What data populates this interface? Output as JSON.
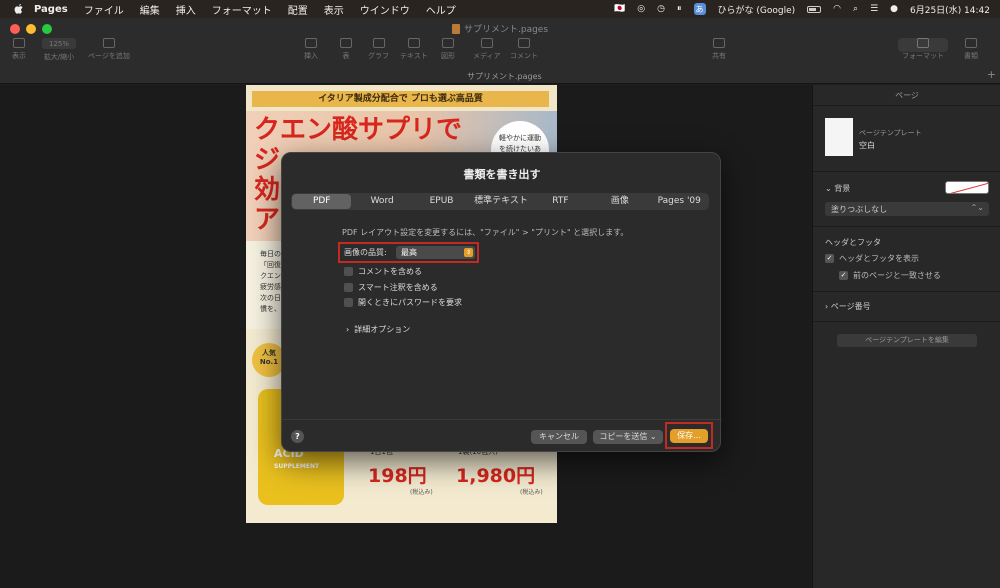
{
  "menubar": {
    "app_name": "Pages",
    "items": [
      "ファイル",
      "編集",
      "挿入",
      "フォーマット",
      "配置",
      "表示",
      "ウインドウ",
      "ヘルプ"
    ],
    "ime_badge": "あ",
    "ime_label": "ひらがな (Google)",
    "datetime": "6月25日(水) 14:42"
  },
  "window": {
    "title": "サプリメント.pages",
    "subtitle": "サプリメント.pages",
    "toolbar": {
      "view": "表示",
      "zoom_value": "125%",
      "zoom": "拡大/縮小",
      "add_page": "ページを追加",
      "insert": "挿入",
      "table": "表",
      "chart": "グラフ",
      "text": "テキスト",
      "shape": "図形",
      "media": "メディア",
      "comment": "コメント",
      "share": "共有",
      "format": "フォーマット",
      "document": "書類"
    }
  },
  "document_page": {
    "banner": "イタリア製成分配合で プロも選ぶ高品質",
    "hero_title": "クエン酸サプリで\nジ\n効\nア",
    "bubble": "軽やかに運動を続けたいあなたへ",
    "mid_text": "毎日の\n「回復\nクエン\n疲労感\n次の日\n慣を、",
    "badge": "人気\nNo.1",
    "bottle_line1": "ACID",
    "bottle_line2": "SUPPLEMENT",
    "price1_label": "1日1包",
    "price1": "198円",
    "price1_tax": "(税込み)",
    "price2_label": "1袋(10包入)",
    "price2": "1,980円",
    "price2_tax": "(税込み)"
  },
  "sidebar": {
    "title": "ページ",
    "template_label": "ページテンプレート",
    "template_value": "空白",
    "background_label": "背景",
    "fill_select": "塗りつぶしなし",
    "header_footer_label": "ヘッダとフッタ",
    "show_header_footer": "ヘッダとフッタを表示",
    "match_previous": "前のページと一致させる",
    "page_number": "ページ番号",
    "edit_template_button": "ページテンプレートを編集"
  },
  "dialog": {
    "title": "書類を書き出す",
    "tabs": [
      "PDF",
      "Word",
      "EPUB",
      "標準テキスト",
      "RTF",
      "画像",
      "Pages '09"
    ],
    "active_tab": "PDF",
    "hint": "PDF レイアウト設定を変更するには、\"ファイル\" > \"プリント\" と選択します。",
    "quality_label": "画像の品質:",
    "quality_value": "最高",
    "checkboxes": [
      "コメントを含める",
      "スマート注釈を含める",
      "開くときにパスワードを要求"
    ],
    "advanced": "詳細オプション",
    "help": "?",
    "cancel": "キャンセル",
    "send_copy": "コピーを送信",
    "save": "保存..."
  },
  "colors": {
    "accent": "#e49f2b",
    "highlight_box": "#c42a24"
  }
}
